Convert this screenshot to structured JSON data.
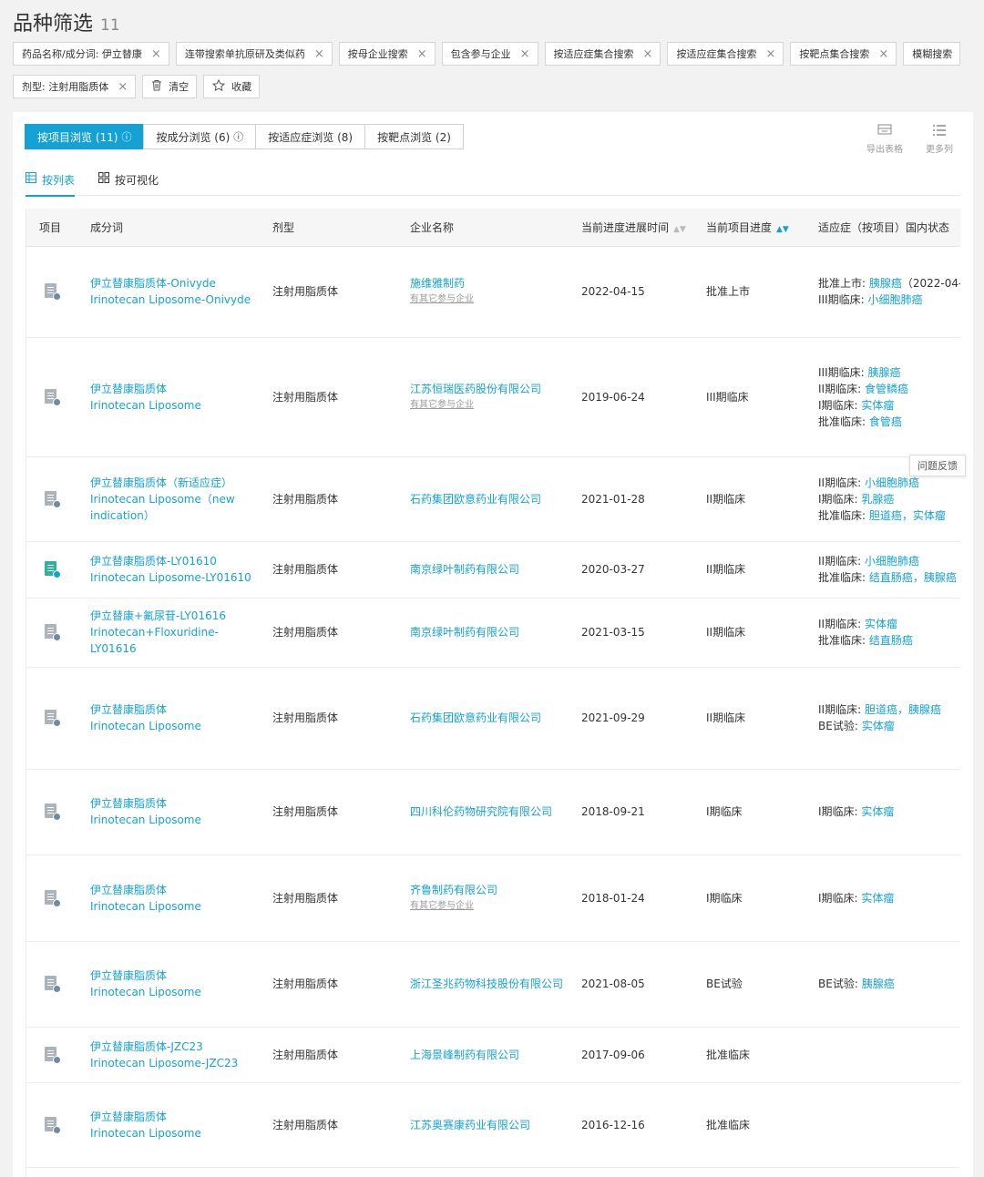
{
  "page": {
    "title": "品种筛选",
    "count": "11"
  },
  "filters": {
    "row1": [
      {
        "label": "药品名称/成分词: 伊立替康",
        "close": "×"
      },
      {
        "label": "连带搜索单抗原研及类似药",
        "close": "×"
      },
      {
        "label": "按母企业搜索",
        "close": "×"
      },
      {
        "label": "包含参与企业",
        "close": "×"
      },
      {
        "label": "按适应症集合搜索",
        "close": "×"
      },
      {
        "label": "按适应症集合搜索",
        "close": "×"
      },
      {
        "label": "按靶点集合搜索",
        "close": "×"
      },
      {
        "label": "模糊搜索"
      }
    ],
    "row2": {
      "dosage": {
        "label": "剂型: 注射用脂质体",
        "close": "×"
      },
      "clear": {
        "label": "清空",
        "icon": "trash-icon"
      },
      "favorite": {
        "label": "收藏",
        "icon": "star-icon"
      }
    }
  },
  "tabs": [
    {
      "label": "按项目浏览 (11)",
      "help": "ⓘ",
      "active": true
    },
    {
      "label": "按成分浏览 (6)",
      "help": "ⓘ",
      "active": false
    },
    {
      "label": "按适应症浏览 (8)",
      "active": false
    },
    {
      "label": "按靶点浏览 (2)",
      "active": false
    }
  ],
  "tools": {
    "export": "导出表格",
    "more_cols": "更多列"
  },
  "views": {
    "list": "按列表",
    "visual": "按可视化"
  },
  "table": {
    "headers": [
      "项目",
      "成分词",
      "剂型",
      "企业名称",
      "当前进度进展时间",
      "当前项目进度",
      "适应症（按项目）国内状态"
    ],
    "rows": [
      {
        "icon": "gray",
        "cn": "伊立替康脂质体-Onivyde",
        "en": "Irinotecan Liposome-Onivyde",
        "form": "注射用脂质体",
        "company": "施维雅制药",
        "company_sub": "有其它参与企业",
        "date": "2022-04-15",
        "stage": "批准上市",
        "ind": [
          {
            "label": "批准上市: ",
            "items": "胰腺癌",
            "tail": "（2022-04-"
          },
          {
            "label": "III期临床: ",
            "items": "小细胞肺癌",
            "tail": ""
          }
        ]
      },
      {
        "icon": "gray",
        "cn": "伊立替康脂质体",
        "en": "Irinotecan Liposome",
        "form": "注射用脂质体",
        "company": "江苏恒瑞医药股份有限公司",
        "company_sub": "有其它参与企业",
        "date": "2019-06-24",
        "stage": "III期临床",
        "ind": [
          {
            "label": "III期临床: ",
            "items": "胰腺癌",
            "tail": ""
          },
          {
            "label": "II期临床: ",
            "items": "食管鳞癌",
            "tail": ""
          },
          {
            "label": "I期临床: ",
            "items": "实体瘤",
            "tail": ""
          },
          {
            "label": "批准临床: ",
            "items": "食管癌",
            "tail": ""
          }
        ]
      },
      {
        "icon": "gray",
        "cn": "伊立替康脂质体（新适应症）",
        "en": "Irinotecan Liposome（new indication）",
        "form": "注射用脂质体",
        "company": "石药集团欧意药业有限公司",
        "company_sub": "",
        "date": "2021-01-28",
        "stage": "II期临床",
        "ind": [
          {
            "label": "II期临床: ",
            "items": "小细胞肺癌",
            "tail": ""
          },
          {
            "label": "I期临床: ",
            "items": "乳腺癌",
            "tail": ""
          },
          {
            "label": "批准临床: ",
            "items": "胆道癌，实体瘤",
            "tail": ""
          }
        ]
      },
      {
        "icon": "green",
        "cn": "伊立替康脂质体-LY01610",
        "en": "Irinotecan Liposome-LY01610",
        "form": "注射用脂质体",
        "company": "南京绿叶制药有限公司",
        "company_sub": "",
        "date": "2020-03-27",
        "stage": "II期临床",
        "ind": [
          {
            "label": "II期临床: ",
            "items": "小细胞肺癌",
            "tail": ""
          },
          {
            "label": "批准临床: ",
            "items": "结直肠癌，胰腺癌",
            "tail": ""
          }
        ]
      },
      {
        "icon": "gray",
        "cn": "伊立替康+氟尿苷-LY01616",
        "en": "Irinotecan+Floxuridine-LY01616",
        "form": "注射用脂质体",
        "company": "南京绿叶制药有限公司",
        "company_sub": "",
        "date": "2021-03-15",
        "stage": "II期临床",
        "ind": [
          {
            "label": "II期临床: ",
            "items": "实体瘤",
            "tail": ""
          },
          {
            "label": "批准临床: ",
            "items": "结直肠癌",
            "tail": ""
          }
        ]
      },
      {
        "icon": "gray",
        "cn": "伊立替康脂质体",
        "en": "Irinotecan Liposome",
        "form": "注射用脂质体",
        "company": "石药集团欧意药业有限公司",
        "company_sub": "",
        "date": "2021-09-29",
        "stage": "II期临床",
        "ind": [
          {
            "label": "II期临床: ",
            "items": "胆道癌，胰腺癌",
            "tail": ""
          },
          {
            "label": "BE试验: ",
            "items": "实体瘤",
            "tail": ""
          }
        ]
      },
      {
        "icon": "gray",
        "cn": "伊立替康脂质体",
        "en": "Irinotecan Liposome",
        "form": "注射用脂质体",
        "company": "四川科伦药物研究院有限公司",
        "company_sub": "",
        "date": "2018-09-21",
        "stage": "I期临床",
        "ind": [
          {
            "label": "I期临床: ",
            "items": "实体瘤",
            "tail": ""
          }
        ]
      },
      {
        "icon": "gray",
        "cn": "伊立替康脂质体",
        "en": "Irinotecan Liposome",
        "form": "注射用脂质体",
        "company": "齐鲁制药有限公司",
        "company_sub": "有其它参与企业",
        "date": "2018-01-24",
        "stage": "I期临床",
        "ind": [
          {
            "label": "I期临床: ",
            "items": "实体瘤",
            "tail": ""
          }
        ]
      },
      {
        "icon": "gray",
        "cn": "伊立替康脂质体",
        "en": "Irinotecan Liposome",
        "form": "注射用脂质体",
        "company": "浙江圣兆药物科技股份有限公司",
        "company_sub": "",
        "date": "2021-08-05",
        "stage": "BE试验",
        "ind": [
          {
            "label": "BE试验: ",
            "items": "胰腺癌",
            "tail": ""
          }
        ]
      },
      {
        "icon": "gray",
        "cn": "伊立替康脂质体-JZC23",
        "en": "Irinotecan Liposome-JZC23",
        "form": "注射用脂质体",
        "company": "上海景峰制药有限公司",
        "company_sub": "",
        "date": "2017-09-06",
        "stage": "批准临床",
        "ind": []
      },
      {
        "icon": "gray",
        "cn": "伊立替康脂质体",
        "en": "Irinotecan Liposome",
        "form": "注射用脂质体",
        "company": "江苏奥赛康药业有限公司",
        "company_sub": "",
        "date": "2016-12-16",
        "stage": "批准临床",
        "ind": []
      }
    ]
  },
  "feedback": "问题反馈",
  "colors": {
    "accent": "#14a2d4"
  }
}
